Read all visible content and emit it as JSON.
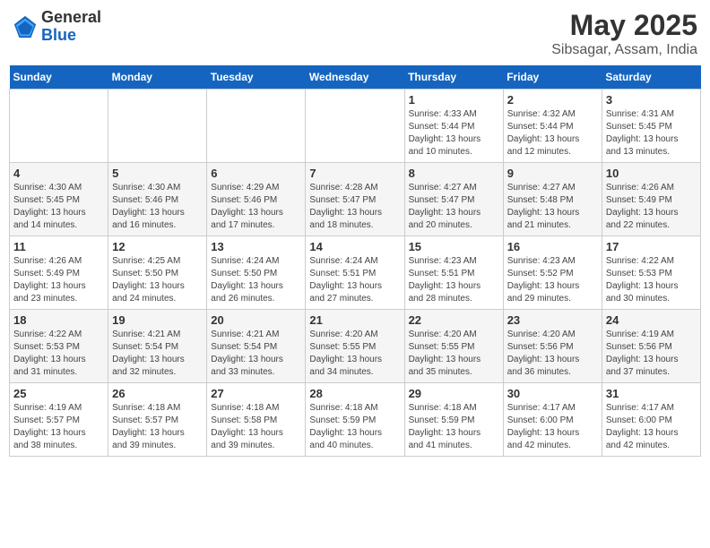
{
  "header": {
    "logo_general": "General",
    "logo_blue": "Blue",
    "main_title": "May 2025",
    "sub_title": "Sibsagar, Assam, India"
  },
  "days_of_week": [
    "Sunday",
    "Monday",
    "Tuesday",
    "Wednesday",
    "Thursday",
    "Friday",
    "Saturday"
  ],
  "weeks": [
    [
      {
        "day": "",
        "info": ""
      },
      {
        "day": "",
        "info": ""
      },
      {
        "day": "",
        "info": ""
      },
      {
        "day": "",
        "info": ""
      },
      {
        "day": "1",
        "info": "Sunrise: 4:33 AM\nSunset: 5:44 PM\nDaylight: 13 hours\nand 10 minutes."
      },
      {
        "day": "2",
        "info": "Sunrise: 4:32 AM\nSunset: 5:44 PM\nDaylight: 13 hours\nand 12 minutes."
      },
      {
        "day": "3",
        "info": "Sunrise: 4:31 AM\nSunset: 5:45 PM\nDaylight: 13 hours\nand 13 minutes."
      }
    ],
    [
      {
        "day": "4",
        "info": "Sunrise: 4:30 AM\nSunset: 5:45 PM\nDaylight: 13 hours\nand 14 minutes."
      },
      {
        "day": "5",
        "info": "Sunrise: 4:30 AM\nSunset: 5:46 PM\nDaylight: 13 hours\nand 16 minutes."
      },
      {
        "day": "6",
        "info": "Sunrise: 4:29 AM\nSunset: 5:46 PM\nDaylight: 13 hours\nand 17 minutes."
      },
      {
        "day": "7",
        "info": "Sunrise: 4:28 AM\nSunset: 5:47 PM\nDaylight: 13 hours\nand 18 minutes."
      },
      {
        "day": "8",
        "info": "Sunrise: 4:27 AM\nSunset: 5:47 PM\nDaylight: 13 hours\nand 20 minutes."
      },
      {
        "day": "9",
        "info": "Sunrise: 4:27 AM\nSunset: 5:48 PM\nDaylight: 13 hours\nand 21 minutes."
      },
      {
        "day": "10",
        "info": "Sunrise: 4:26 AM\nSunset: 5:49 PM\nDaylight: 13 hours\nand 22 minutes."
      }
    ],
    [
      {
        "day": "11",
        "info": "Sunrise: 4:26 AM\nSunset: 5:49 PM\nDaylight: 13 hours\nand 23 minutes."
      },
      {
        "day": "12",
        "info": "Sunrise: 4:25 AM\nSunset: 5:50 PM\nDaylight: 13 hours\nand 24 minutes."
      },
      {
        "day": "13",
        "info": "Sunrise: 4:24 AM\nSunset: 5:50 PM\nDaylight: 13 hours\nand 26 minutes."
      },
      {
        "day": "14",
        "info": "Sunrise: 4:24 AM\nSunset: 5:51 PM\nDaylight: 13 hours\nand 27 minutes."
      },
      {
        "day": "15",
        "info": "Sunrise: 4:23 AM\nSunset: 5:51 PM\nDaylight: 13 hours\nand 28 minutes."
      },
      {
        "day": "16",
        "info": "Sunrise: 4:23 AM\nSunset: 5:52 PM\nDaylight: 13 hours\nand 29 minutes."
      },
      {
        "day": "17",
        "info": "Sunrise: 4:22 AM\nSunset: 5:53 PM\nDaylight: 13 hours\nand 30 minutes."
      }
    ],
    [
      {
        "day": "18",
        "info": "Sunrise: 4:22 AM\nSunset: 5:53 PM\nDaylight: 13 hours\nand 31 minutes."
      },
      {
        "day": "19",
        "info": "Sunrise: 4:21 AM\nSunset: 5:54 PM\nDaylight: 13 hours\nand 32 minutes."
      },
      {
        "day": "20",
        "info": "Sunrise: 4:21 AM\nSunset: 5:54 PM\nDaylight: 13 hours\nand 33 minutes."
      },
      {
        "day": "21",
        "info": "Sunrise: 4:20 AM\nSunset: 5:55 PM\nDaylight: 13 hours\nand 34 minutes."
      },
      {
        "day": "22",
        "info": "Sunrise: 4:20 AM\nSunset: 5:55 PM\nDaylight: 13 hours\nand 35 minutes."
      },
      {
        "day": "23",
        "info": "Sunrise: 4:20 AM\nSunset: 5:56 PM\nDaylight: 13 hours\nand 36 minutes."
      },
      {
        "day": "24",
        "info": "Sunrise: 4:19 AM\nSunset: 5:56 PM\nDaylight: 13 hours\nand 37 minutes."
      }
    ],
    [
      {
        "day": "25",
        "info": "Sunrise: 4:19 AM\nSunset: 5:57 PM\nDaylight: 13 hours\nand 38 minutes."
      },
      {
        "day": "26",
        "info": "Sunrise: 4:18 AM\nSunset: 5:57 PM\nDaylight: 13 hours\nand 39 minutes."
      },
      {
        "day": "27",
        "info": "Sunrise: 4:18 AM\nSunset: 5:58 PM\nDaylight: 13 hours\nand 39 minutes."
      },
      {
        "day": "28",
        "info": "Sunrise: 4:18 AM\nSunset: 5:59 PM\nDaylight: 13 hours\nand 40 minutes."
      },
      {
        "day": "29",
        "info": "Sunrise: 4:18 AM\nSunset: 5:59 PM\nDaylight: 13 hours\nand 41 minutes."
      },
      {
        "day": "30",
        "info": "Sunrise: 4:17 AM\nSunset: 6:00 PM\nDaylight: 13 hours\nand 42 minutes."
      },
      {
        "day": "31",
        "info": "Sunrise: 4:17 AM\nSunset: 6:00 PM\nDaylight: 13 hours\nand 42 minutes."
      }
    ]
  ]
}
